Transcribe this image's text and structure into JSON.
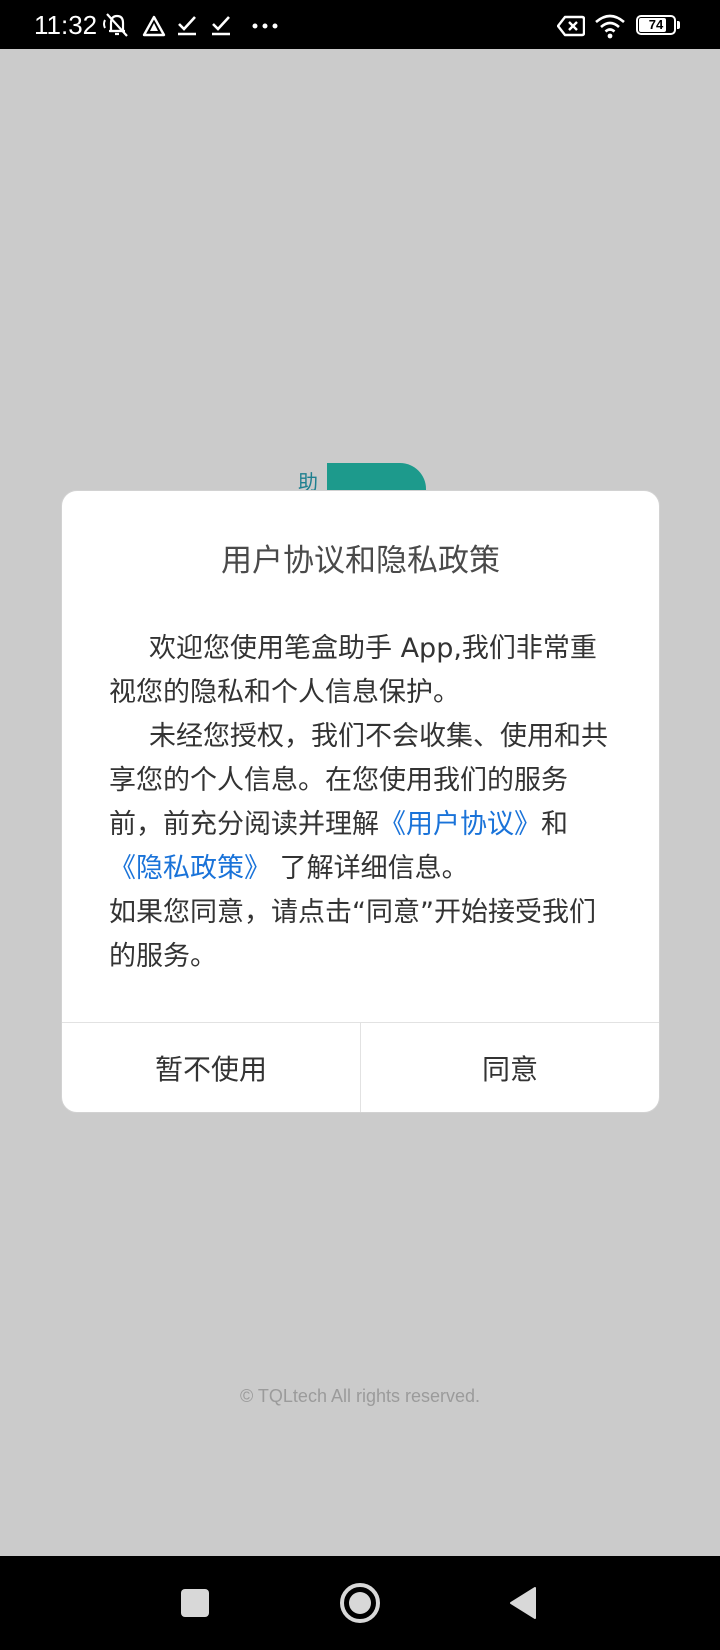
{
  "status_bar": {
    "time": "11:32",
    "battery_level": "74",
    "icons": [
      "muted-bell-icon",
      "warning-icon",
      "checkmark-icon",
      "checkmark-icon",
      "more-dots-icon",
      "x-box-icon",
      "wifi-icon",
      "battery-icon"
    ]
  },
  "splash": {
    "logo_char": "助",
    "copyright": "© TQLtech All rights reserved.",
    "accent_color": "#1d9a8c"
  },
  "dialog": {
    "title": "用户协议和隐私政策",
    "para1": "欢迎您使用笔盒助手 App,我们非常重视您的隐私和个人信息保护。",
    "para2_a": "未经您授权，我们不会收集、使用和共享您的个人信息。在您使用我们的服务前，前充分阅读并理解",
    "link_user_agreement": "《用户协议》",
    "para2_and": "和",
    "link_privacy_policy": "《隐私政策》",
    "para2_b": " 了解详细信息。",
    "para3": "如果您同意，请点击“同意”开始接受我们的服务。",
    "decline_label": "暂不使用",
    "agree_label": "同意",
    "link_color": "#1a73d9"
  },
  "nav_bar": {
    "icons": [
      "recents-square-icon",
      "home-circle-icon",
      "back-triangle-icon"
    ]
  }
}
